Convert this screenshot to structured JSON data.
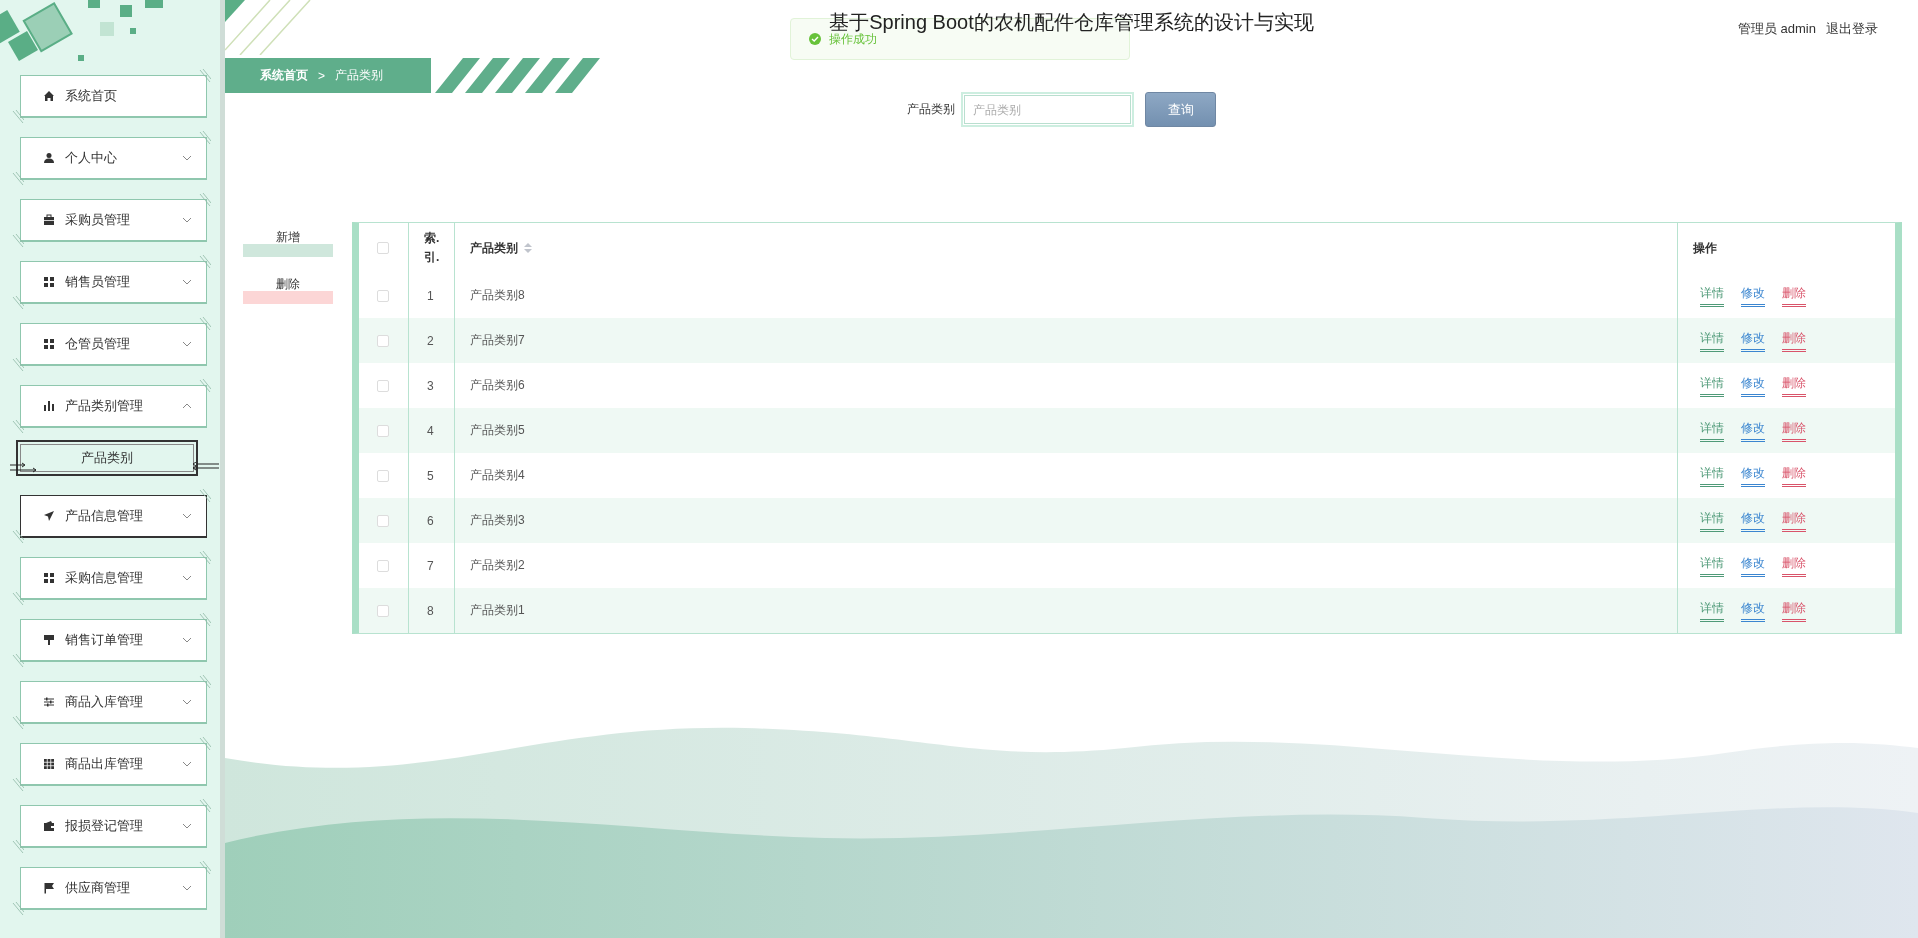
{
  "header": {
    "title": "基于Spring Boot的农机配件仓库管理系统的设计与实现",
    "user": "管理员 admin",
    "logout": "退出登录"
  },
  "toast": {
    "message": "操作成功"
  },
  "sidebar": {
    "items": [
      {
        "label": "系统首页",
        "kind": "link",
        "hovered": false
      },
      {
        "label": "个人中心",
        "kind": "submenu",
        "expanded": false,
        "hovered": false
      },
      {
        "label": "采购员管理",
        "kind": "submenu",
        "expanded": false,
        "hovered": false
      },
      {
        "label": "销售员管理",
        "kind": "submenu",
        "expanded": false,
        "hovered": false
      },
      {
        "label": "仓管员管理",
        "kind": "submenu",
        "expanded": false,
        "hovered": false
      },
      {
        "label": "产品类别管理",
        "kind": "submenu",
        "expanded": true,
        "hovered": false,
        "children": [
          {
            "label": "产品类别",
            "selected": true
          }
        ]
      },
      {
        "label": "产品信息管理",
        "kind": "submenu",
        "expanded": false,
        "hovered": true
      },
      {
        "label": "采购信息管理",
        "kind": "submenu",
        "expanded": false,
        "hovered": false
      },
      {
        "label": "销售订单管理",
        "kind": "submenu",
        "expanded": false,
        "hovered": false
      },
      {
        "label": "商品入库管理",
        "kind": "submenu",
        "expanded": false,
        "hovered": false
      },
      {
        "label": "商品出库管理",
        "kind": "submenu",
        "expanded": false,
        "hovered": false
      },
      {
        "label": "报损登记管理",
        "kind": "submenu",
        "expanded": false,
        "hovered": false
      },
      {
        "label": "供应商管理",
        "kind": "submenu",
        "expanded": false,
        "hovered": false
      }
    ]
  },
  "breadcrumb": [
    "系统首页",
    ">",
    "产品类别"
  ],
  "search": {
    "label": "产品类别",
    "placeholder": "产品类别",
    "button": "查询"
  },
  "actions": [
    "新增",
    "删除"
  ],
  "table": {
    "all_checked": false,
    "columns": [
      "索.引.",
      "产品类别",
      "操作"
    ],
    "rows": [
      {
        "index": "1",
        "category": "产品类别8",
        "checked": false,
        "ops": [
          "详情",
          "修改",
          "删除"
        ]
      },
      {
        "index": "2",
        "category": "产品类别7",
        "checked": false,
        "ops": [
          "详情",
          "修改",
          "删除"
        ]
      },
      {
        "index": "3",
        "category": "产品类别6",
        "checked": false,
        "ops": [
          "详情",
          "修改",
          "删除"
        ]
      },
      {
        "index": "4",
        "category": "产品类别5",
        "checked": false,
        "ops": [
          "详情",
          "修改",
          "删除"
        ]
      },
      {
        "index": "5",
        "category": "产品类别4",
        "checked": false,
        "ops": [
          "详情",
          "修改",
          "删除"
        ]
      },
      {
        "index": "6",
        "category": "产品类别3",
        "checked": false,
        "ops": [
          "详情",
          "修改",
          "删除"
        ]
      },
      {
        "index": "7",
        "category": "产品类别2",
        "checked": false,
        "ops": [
          "详情",
          "修改",
          "删除"
        ]
      },
      {
        "index": "8",
        "category": "产品类别1",
        "checked": false,
        "ops": [
          "详情",
          "修改",
          "删除"
        ]
      }
    ]
  }
}
